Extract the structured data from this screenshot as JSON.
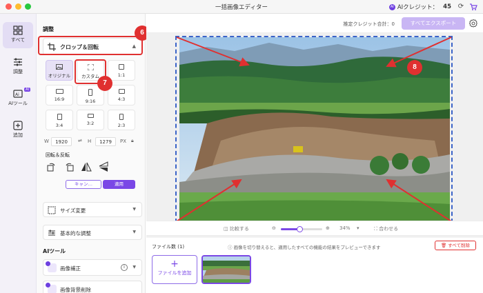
{
  "window": {
    "title": "一括画像エディター",
    "credit_label": "AIクレジット：",
    "credit_value": "45",
    "ai_badge": "AI"
  },
  "rail": {
    "items": [
      {
        "label": "すべて",
        "icon": "grid-icon",
        "active": true
      },
      {
        "label": "調整",
        "icon": "sliders-icon",
        "active": false
      },
      {
        "label": "AIツール",
        "icon": "ai-tool-icon",
        "active": false
      },
      {
        "label": "追加",
        "icon": "plus-square-icon",
        "active": false
      }
    ],
    "ai_badge": "AI"
  },
  "panel": {
    "section_adjust": "調整",
    "crop": {
      "title": "クロップ＆回転",
      "ratios": [
        {
          "label": "オリジナル",
          "selected": true
        },
        {
          "label": "カスタム",
          "selected": false
        },
        {
          "label": "1:1",
          "selected": false
        },
        {
          "label": "16:9",
          "selected": false
        },
        {
          "label": "9:16",
          "selected": false
        },
        {
          "label": "4:3",
          "selected": false
        },
        {
          "label": "3:4",
          "selected": false
        },
        {
          "label": "3:2",
          "selected": false
        },
        {
          "label": "2:3",
          "selected": false
        }
      ],
      "w_label": "W",
      "w_value": "1920",
      "h_label": "H",
      "h_value": "1279",
      "unit": "PX",
      "rotate_label": "回転＆反転",
      "cancel": "キャン…",
      "apply": "適用"
    },
    "resize": "サイズ変更",
    "basic_adjust": "基本的な調整",
    "section_ai": "AIツール",
    "ai_tools": [
      "画像補正",
      "画像背景削除"
    ]
  },
  "main": {
    "estimated_credits_label": "推定クレジット合計：",
    "estimated_credits_value": "0",
    "export_all": "すべてエクスポート",
    "compare": "比較する",
    "zoom_level": "34%",
    "zoom_fraction": 0.45,
    "fit": "合わせる",
    "file_count_label": "ファイル数",
    "file_count": "(1)",
    "preview_note": "画像を切り替えると、適用したすべての機能の結果をプレビューできます",
    "delete_all": "すべて削除",
    "add_file": "ファイルを追加"
  },
  "callouts": [
    "6",
    "7",
    "8"
  ],
  "colors": {
    "accent": "#7a47e6",
    "callout_red": "#e03030",
    "crop_frame": "#3a63c8"
  }
}
